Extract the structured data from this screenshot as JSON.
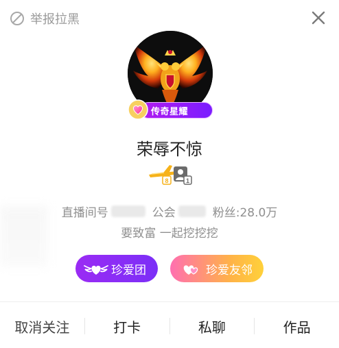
{
  "top_bar": {
    "report_label": "举报拉黑",
    "report_icon": "prohibited-icon",
    "close_icon": "close-icon"
  },
  "profile": {
    "avatar_icon": "phoenix-avatar",
    "legend_badge_label": "传奇星耀",
    "nickname": "荣辱不惊",
    "level_badges": [
      "plane-badge",
      "user-badge"
    ],
    "stats": {
      "room_label": "直播间号",
      "guild_label": "公会",
      "fans_label": "粉丝:",
      "fans_value": "28.0万"
    },
    "signature": "要致富 一起挖挖挖"
  },
  "pills": {
    "fan_group": "珍爱团",
    "friend_neighbor": "珍爱友邻"
  },
  "actions": {
    "unfollow": "取消关注",
    "checkin": "打卡",
    "private_chat": "私聊",
    "works": "作品"
  },
  "colors": {
    "fan_group_pill": "#8a2df5",
    "friend_pill_start": "#ff6fb0",
    "friend_pill_end": "#ffd13a",
    "legend_badge": "#9b1df4"
  }
}
